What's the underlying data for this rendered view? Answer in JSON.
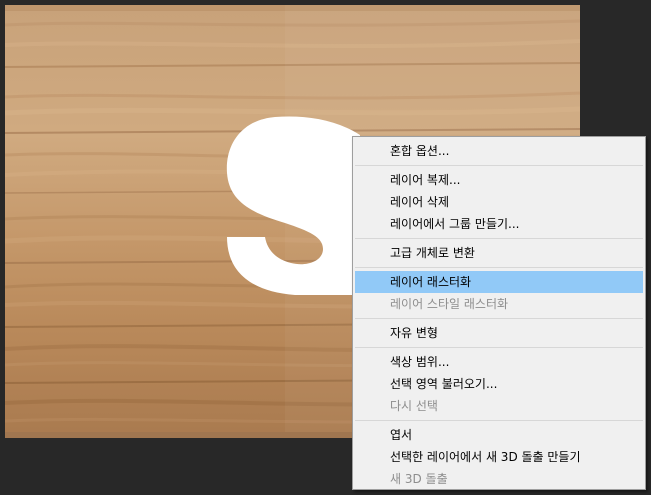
{
  "canvas": {
    "image_description": "wooden plank background with large white letter",
    "letter": "S",
    "wood_base_color": "#c49a6c",
    "letter_color": "#ffffff"
  },
  "context_menu": {
    "highlight_color": "#91c9f7",
    "groups": [
      [
        {
          "label": "혼합 옵션...",
          "enabled": true
        }
      ],
      [
        {
          "label": "레이어 복제...",
          "enabled": true
        },
        {
          "label": "레이어 삭제",
          "enabled": true
        },
        {
          "label": "레이어에서 그룹 만들기...",
          "enabled": true
        }
      ],
      [
        {
          "label": "고급 개체로 변환",
          "enabled": true
        }
      ],
      [
        {
          "label": "레이어 래스터화",
          "enabled": true,
          "highlighted": true
        },
        {
          "label": "레이어 스타일 래스터화",
          "enabled": false
        }
      ],
      [
        {
          "label": "자유 변형",
          "enabled": true
        }
      ],
      [
        {
          "label": "색상 범위...",
          "enabled": true
        },
        {
          "label": "선택 영역 불러오기...",
          "enabled": true
        },
        {
          "label": "다시 선택",
          "enabled": false
        }
      ],
      [
        {
          "label": "엽서",
          "enabled": true
        },
        {
          "label": "선택한 레이어에서 새 3D 돌출 만들기",
          "enabled": true
        },
        {
          "label": "새 3D 돌출",
          "enabled": false
        }
      ]
    ]
  }
}
